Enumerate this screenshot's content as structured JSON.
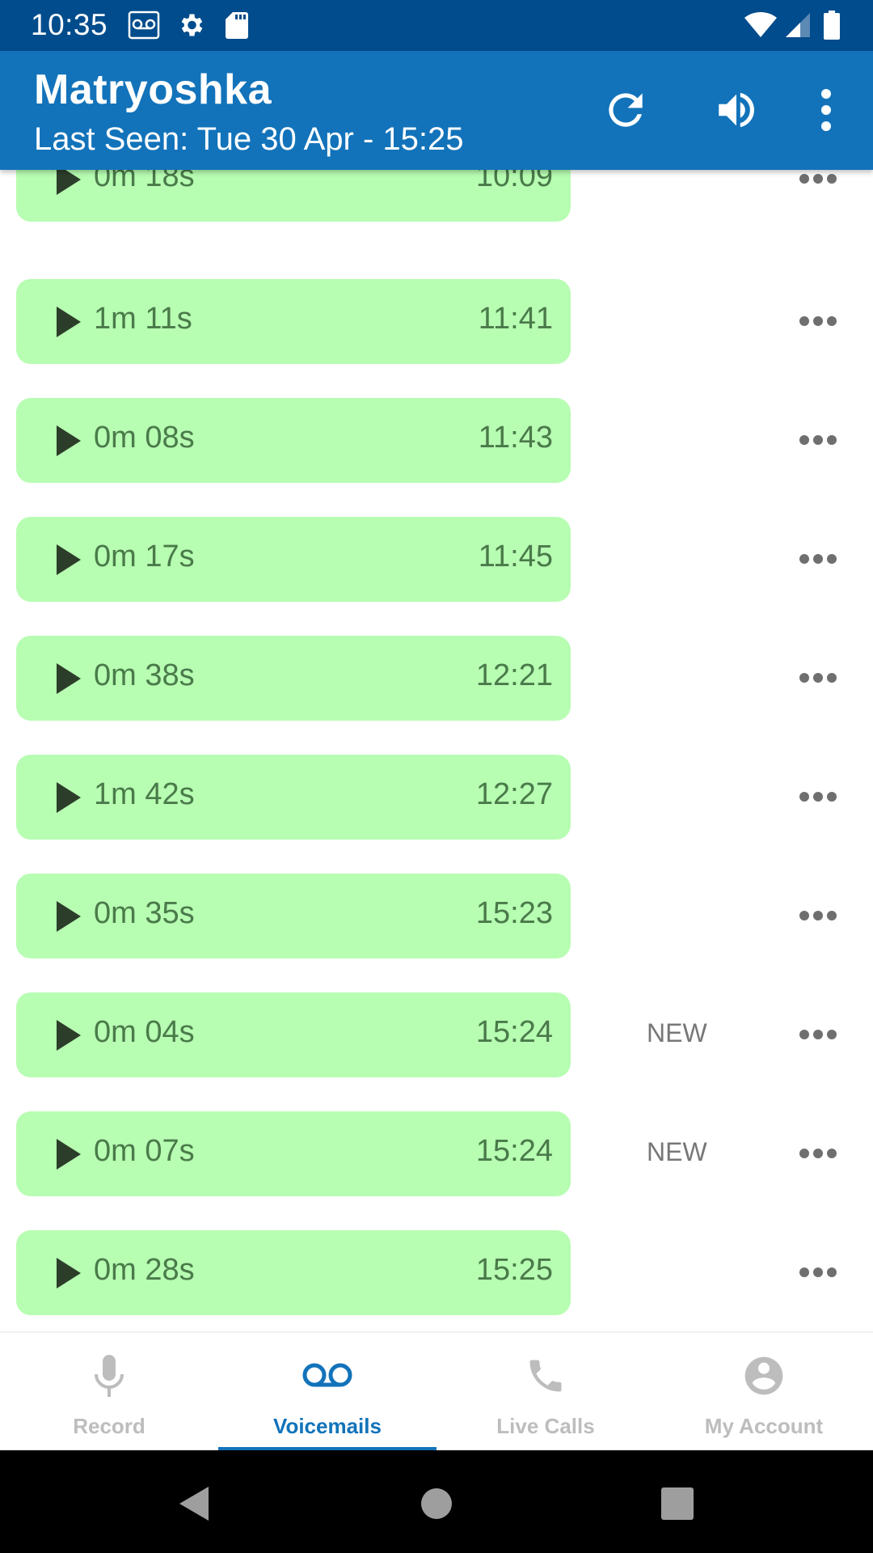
{
  "status_bar": {
    "time": "10:35",
    "left_icons": [
      "voicemail-icon",
      "settings-gear-icon",
      "sd-card-icon"
    ],
    "right_icons": [
      "wifi-icon",
      "cell-signal-icon",
      "battery-icon"
    ]
  },
  "app_bar": {
    "title": "Matryoshka",
    "subtitle": "Last Seen: Tue 30 Apr - 15:25",
    "actions": [
      "refresh-icon",
      "volume-icon",
      "more-vert-icon"
    ],
    "color": "#1273ba",
    "status_color": "#004c8c"
  },
  "voicemails": [
    {
      "duration": "0m 18s",
      "time": "10:09",
      "badge": ""
    },
    {
      "duration": "1m 11s",
      "time": "11:41",
      "badge": ""
    },
    {
      "duration": "0m 08s",
      "time": "11:43",
      "badge": ""
    },
    {
      "duration": "0m 17s",
      "time": "11:45",
      "badge": ""
    },
    {
      "duration": "0m 38s",
      "time": "12:21",
      "badge": ""
    },
    {
      "duration": "1m 42s",
      "time": "12:27",
      "badge": ""
    },
    {
      "duration": "0m 35s",
      "time": "15:23",
      "badge": ""
    },
    {
      "duration": "0m 04s",
      "time": "15:24",
      "badge": "NEW"
    },
    {
      "duration": "0m 07s",
      "time": "15:24",
      "badge": "NEW"
    },
    {
      "duration": "0m 28s",
      "time": "15:25",
      "badge": ""
    }
  ],
  "voicemail_pill_color": "#b7fdb2",
  "bottom_nav": {
    "items": [
      {
        "label": "Record",
        "icon": "microphone-icon",
        "active": false
      },
      {
        "label": "Voicemails",
        "icon": "voicemail-icon",
        "active": true
      },
      {
        "label": "Live Calls",
        "icon": "phone-icon",
        "active": false
      },
      {
        "label": "My Account",
        "icon": "account-circle-icon",
        "active": false
      }
    ],
    "active_color": "#1273ba",
    "inactive_color": "#bdbdbd"
  },
  "system_nav": {
    "buttons": [
      "back-icon",
      "home-icon",
      "recents-icon"
    ]
  }
}
